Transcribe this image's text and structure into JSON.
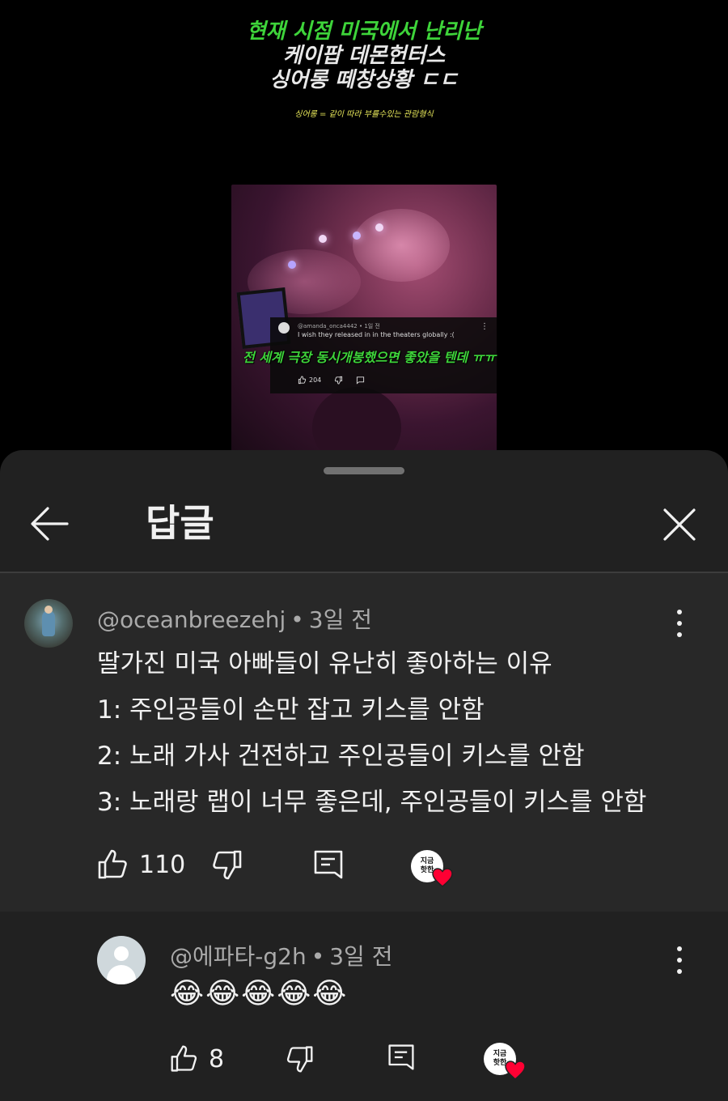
{
  "video": {
    "title_lines": [
      "현재 시점 미국에서 난리난",
      "케이팝 데몬헌터스",
      "싱어롱 떼창상황 ㄷㄷ"
    ],
    "note": "싱어롱 = 같이 따라 부를수있는 관람형식",
    "overlay_comment": {
      "author_meta": "@amanda_onca4442 • 1일 전",
      "text": "I wish they released in in the theaters globally :(",
      "likes": "204"
    },
    "subtitle": "전 세계 극장 동시개봉했으면 좋았을 텐데 ㅠㅠ"
  },
  "sheet": {
    "title": "답글"
  },
  "parent_comment": {
    "author": "@oceanbreezehj",
    "separator": "•",
    "time": "3일 전",
    "lines": [
      "딸가진 미국 아빠들이 유난히 좋아하는 이유",
      "1: 주인공들이 손만 잡고 키스를 안함",
      "2: 노래 가사 건전하고 주인공들이 키스를 안함",
      "3: 노래랑 랩이 너무 좋은데, 주인공들이 키스를 안함"
    ],
    "likes": "110",
    "creator_badge": "지금\n핫한"
  },
  "reply": {
    "author": "@에파타-g2h",
    "separator": "•",
    "time": "3일 전",
    "text": "😂😂😂😂😂",
    "likes": "8",
    "creator_badge": "지금\n핫한"
  },
  "colors": {
    "sheet_bg": "#212121",
    "highlight_bg": "#282828",
    "title_green": "#3ed43a",
    "heart_red": "#ff0033"
  }
}
